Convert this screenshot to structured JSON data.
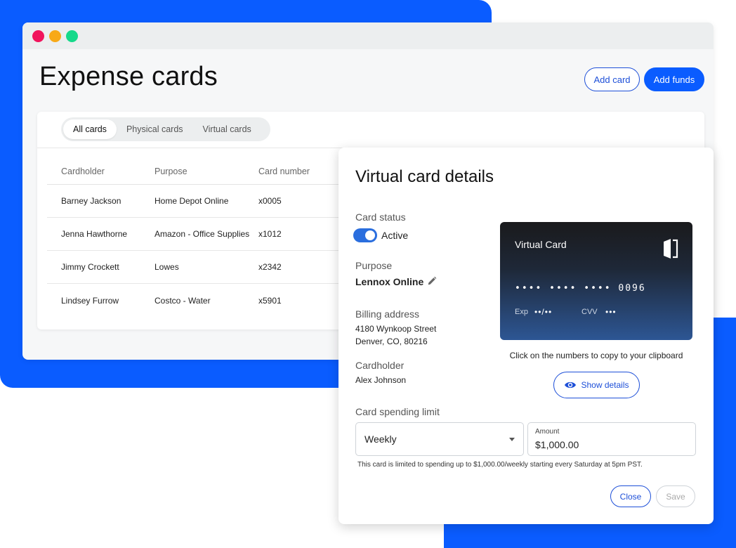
{
  "header": {
    "title": "Expense cards",
    "add_card_label": "Add card",
    "add_funds_label": "Add funds"
  },
  "tabs": [
    "All cards",
    "Physical cards",
    "Virtual cards"
  ],
  "table": {
    "columns": [
      "Cardholder",
      "Purpose",
      "Card number"
    ],
    "rows": [
      {
        "cardholder": "Barney Jackson",
        "purpose": "Home Depot Online",
        "card_number": "x0005"
      },
      {
        "cardholder": "Jenna Hawthorne",
        "purpose": "Amazon - Office Supplies",
        "card_number": "x1012"
      },
      {
        "cardholder": "Jimmy Crockett",
        "purpose": "Lowes",
        "card_number": "x2342"
      },
      {
        "cardholder": "Lindsey Furrow",
        "purpose": "Costco - Water",
        "card_number": "x5901"
      }
    ]
  },
  "modal": {
    "title": "Virtual card details",
    "card_status_label": "Card status",
    "status_value": "Active",
    "purpose_label": "Purpose",
    "purpose_value": "Lennox Online",
    "billing_label": "Billing address",
    "billing_line1": "4180 Wynkoop Street",
    "billing_line2": "Denver, CO, 80216",
    "cardholder_label": "Cardholder",
    "cardholder_value": "Alex Johnson",
    "card": {
      "title": "Virtual Card",
      "number": "•••• •••• •••• 0096",
      "exp_label": "Exp",
      "exp_value": "••/••",
      "cvv_label": "CVV",
      "cvv_value": "•••"
    },
    "clipboard_hint": "Click on the numbers to copy to your clipboard",
    "show_details_label": "Show details",
    "spending_limit_label": "Card spending limit",
    "period_value": "Weekly",
    "amount_label": "Amount",
    "amount_value": "$1,000.00",
    "limit_note": "This card is limited to spending up to $1,000.00/weekly starting every Saturday at 5pm PST.",
    "close_label": "Close",
    "save_label": "Save"
  },
  "colors": {
    "brand_blue": "#0a5cff",
    "accent_blue": "#1d4fd8",
    "traffic_red": "#f1145c",
    "traffic_yellow": "#f8a917",
    "traffic_green": "#15d98a"
  }
}
